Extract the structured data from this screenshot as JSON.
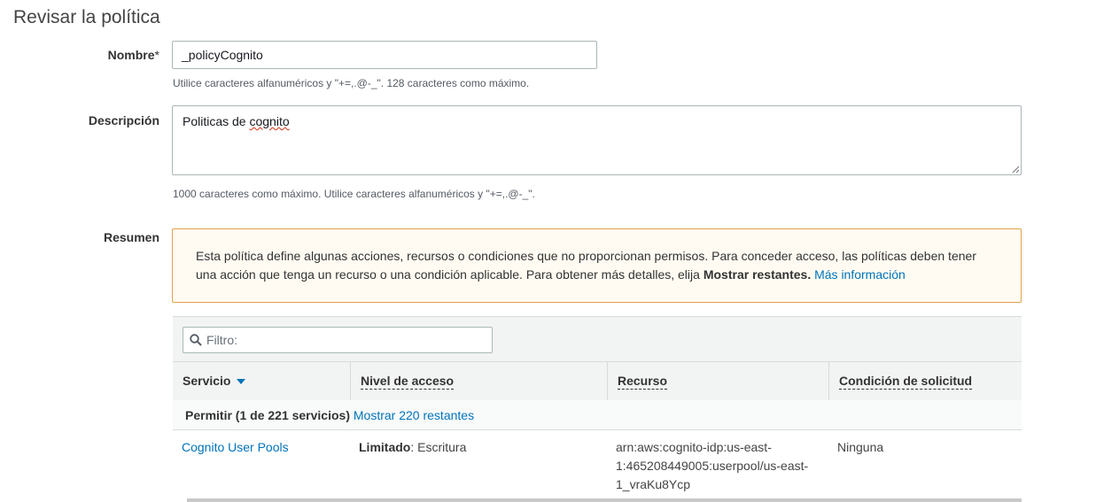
{
  "page": {
    "title": "Revisar la política"
  },
  "form": {
    "name": {
      "label": "Nombre",
      "required_mark": "*",
      "value": "_policyCognito",
      "hint": "Utilice caracteres alfanuméricos y \"+=,.@-_\". 128 caracteres como máximo."
    },
    "description": {
      "label": "Descripción",
      "value_prefix": "Politicas de ",
      "value_misspelled": "cognito",
      "hint": "1000 caracteres como máximo. Utilice caracteres alfanuméricos y \"+=,.@-_\"."
    },
    "summary": {
      "label": "Resumen",
      "alert": {
        "line1": "Esta política define algunas acciones, recursos o condiciones que no proporcionan permisos. Para conceder acceso, las políticas deben tener",
        "line2_prefix": "una acción que tenga un recurso o una condición aplicable. Para obtener más detalles, elija ",
        "line2_bold": "Mostrar restantes.",
        "link": "Más información"
      }
    }
  },
  "table": {
    "filter_placeholder": "Filtro:",
    "columns": [
      "Servicio",
      "Nivel de acceso",
      "Recurso",
      "Condición de solicitud"
    ],
    "group": {
      "label": "Permitir (1 de 221 servicios)",
      "link": "Mostrar 220 restantes"
    },
    "rows": [
      {
        "service": "Cognito User Pools",
        "access_level_bold": "Limitado",
        "access_level_rest": ": Escritura",
        "resource_lines": [
          "arn:aws:cognito-idp:us-east-",
          "1:465208449005:userpool/us-east-",
          "1_vraKu8Ycp"
        ],
        "condition": "Ninguna"
      }
    ]
  },
  "colors": {
    "link": "#0073bb",
    "alert_border": "#e0a24b",
    "alert_bg": "#fffbf2",
    "spellcheck": "#d13212"
  },
  "icons": {
    "filter": "search-icon",
    "sort": "caret-down-icon",
    "resize": "resize-handle-icon"
  }
}
